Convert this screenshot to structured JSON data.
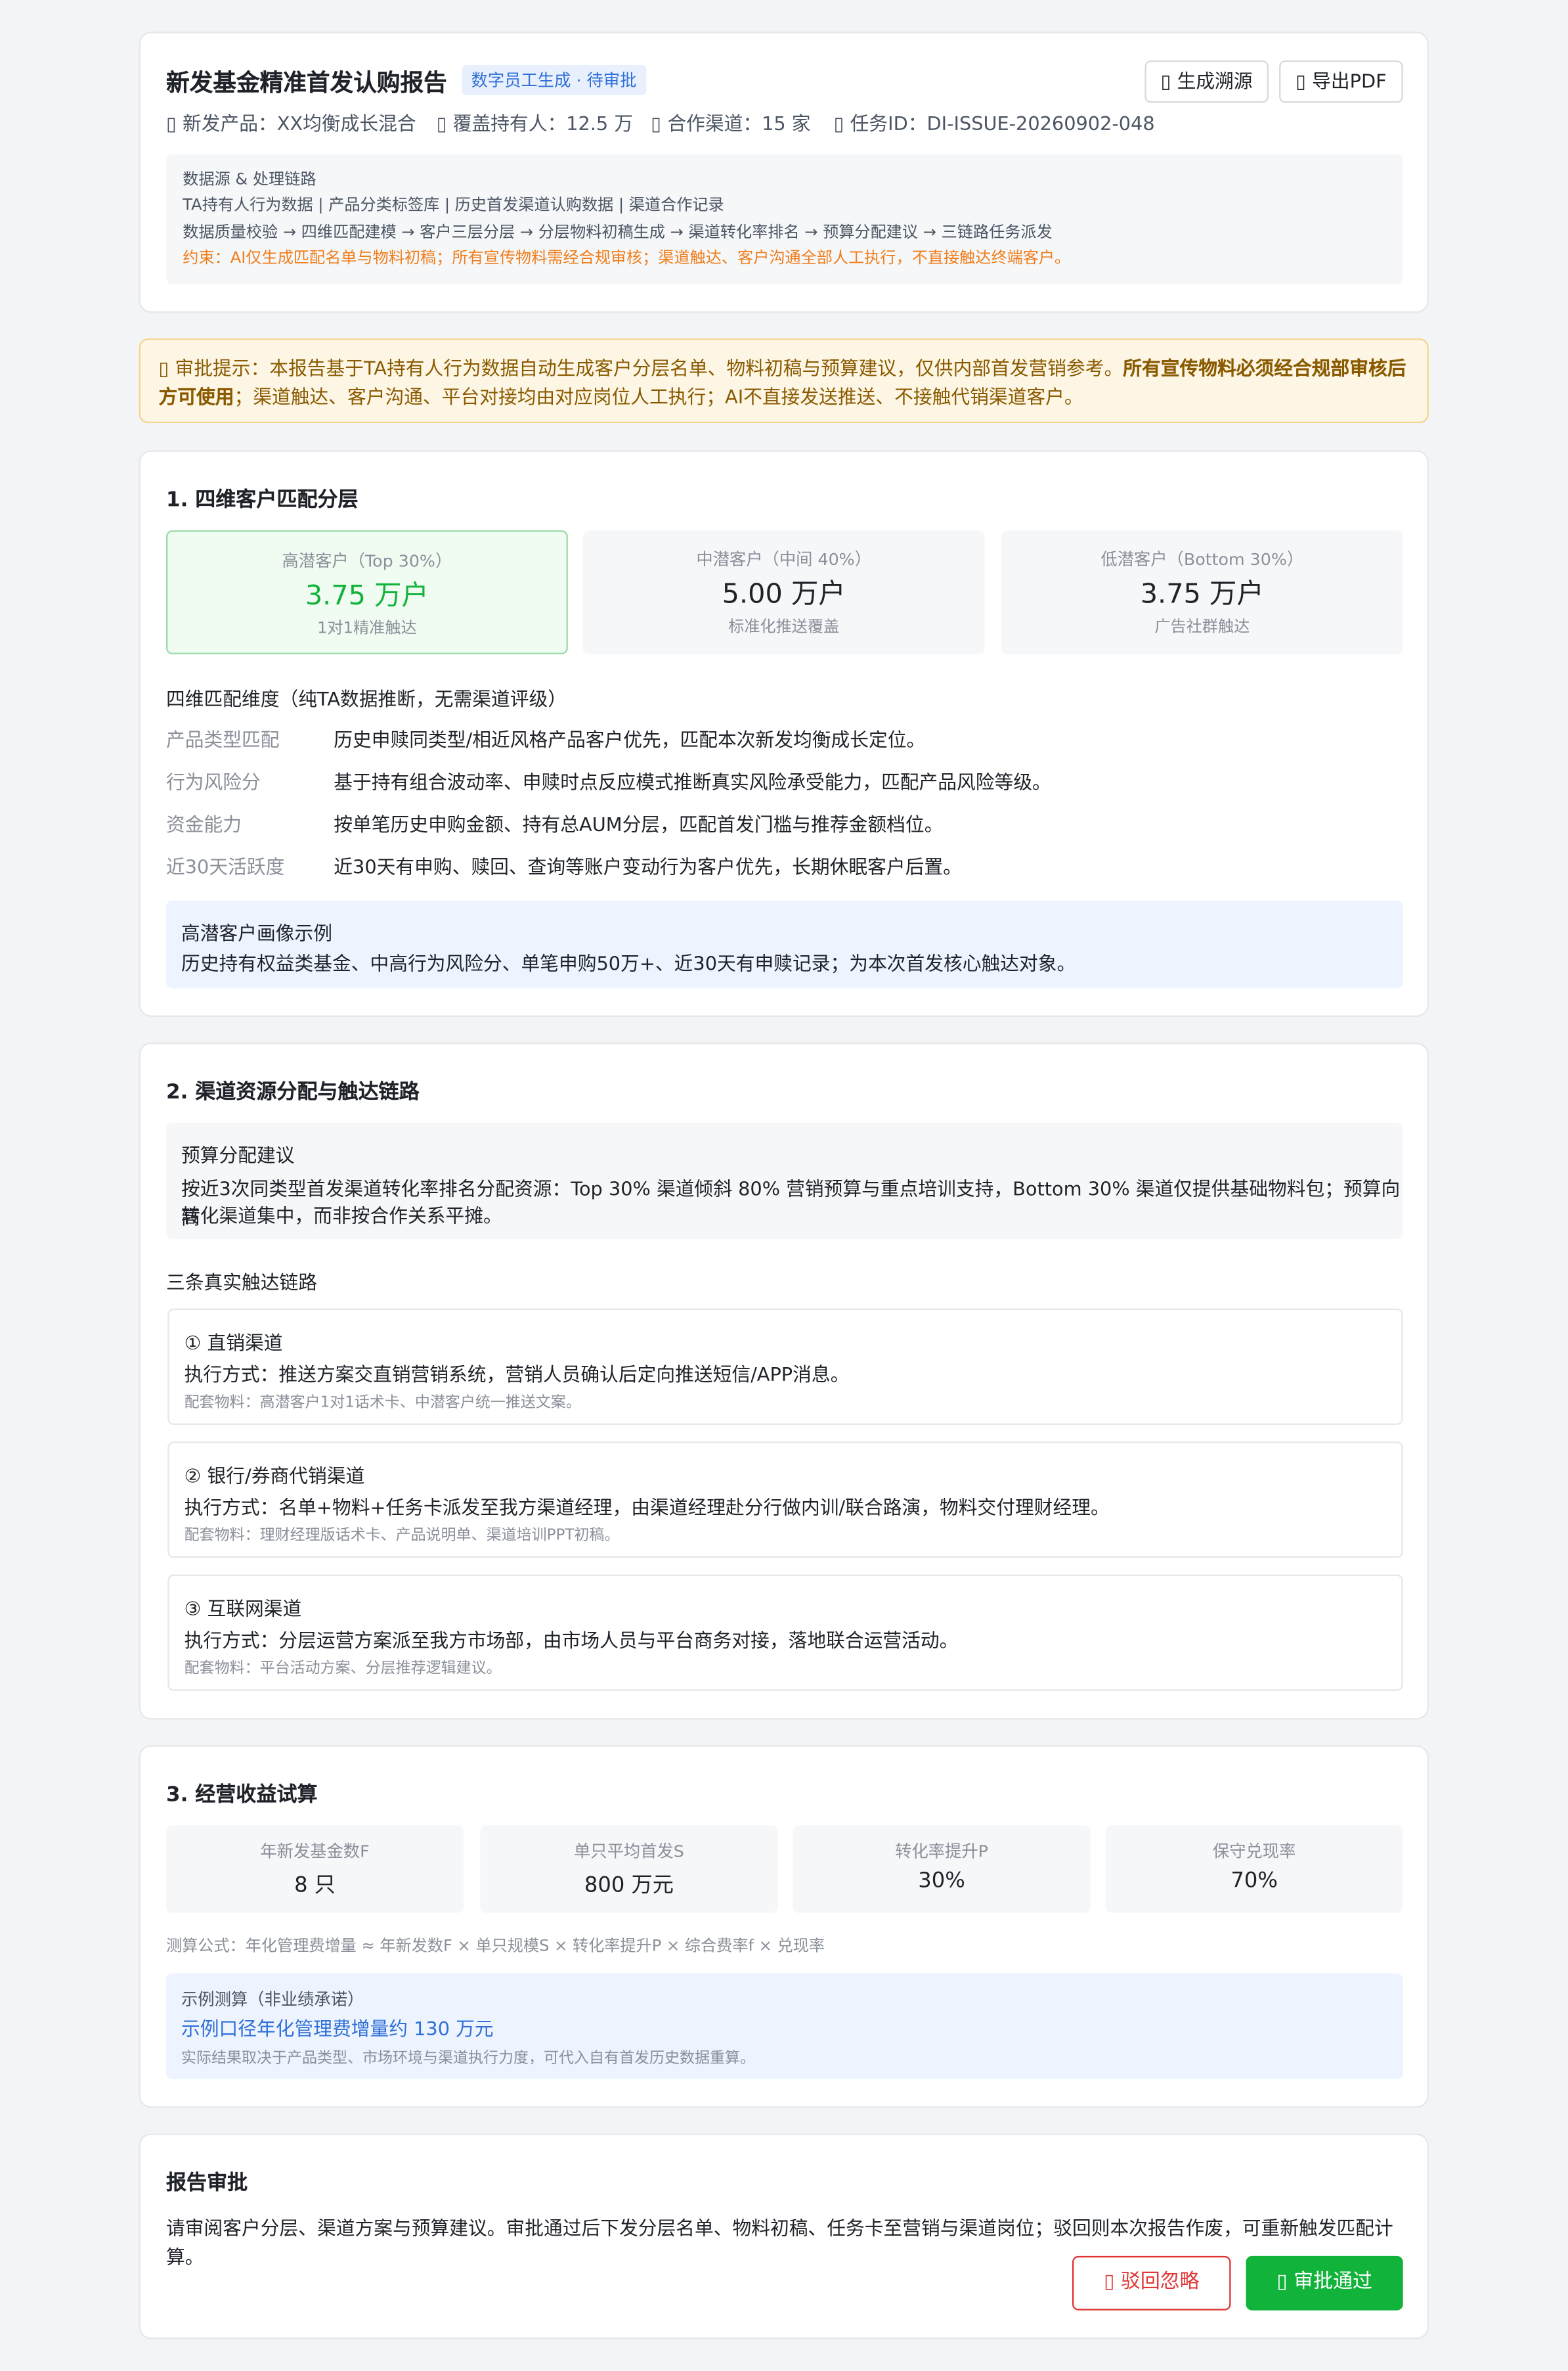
{
  "header": {
    "title": "新发基金精准首发认购报告",
    "tag": "数字员工生成 · 待审批",
    "btn_trace": "生成溯源",
    "btn_export": "导出PDF",
    "meta_product": "新发产品：XX均衡成长混合",
    "meta_holders": "覆盖持有人：12.5 万",
    "meta_channels": "合作渠道：15 家",
    "meta_task": "任务ID：DI-ISSUE-20260902-048",
    "source_title": "数据源 & 处理链路",
    "source_line1": "TA持有人行为数据 | 产品分类标签库 | 历史首发渠道认购数据 | 渠道合作记录",
    "source_line2": "数据质量校验 → 四维匹配建模 → 客户三层分层 → 分层物料初稿生成 → 渠道转化率排名 → 预算分配建议 → 三链路任务派发",
    "constraint": "约束：AI仅生成匹配名单与物料初稿；所有宣传物料需经合规审核；渠道触达、客户沟通全部人工执行，不直接触达终端客户。"
  },
  "notice": {
    "prefix": "审批提示：本报告基于TA持有人行为数据自动生成客户分层名单、物料初稿与预算建议，仅供内部首发营销参考。",
    "bold": "所有宣传物料必须经合规部审核后方可使用",
    "suffix": "；渠道触达、客户沟通、平台对接均由对应岗位人工执行；AI不直接发送推送、不接触代销渠道客户。"
  },
  "s1": {
    "title": "1. 四维客户匹配分层",
    "tiers": [
      {
        "label": "高潜客户（Top 30%）",
        "value": "3.75 万户",
        "sub": "1对1精准触达"
      },
      {
        "label": "中潜客户（中间 40%）",
        "value": "5.00 万户",
        "sub": "标准化推送覆盖"
      },
      {
        "label": "低潜客户（Bottom 30%）",
        "value": "3.75 万户",
        "sub": "广告社群触达"
      }
    ],
    "dims_title": "四维匹配维度（纯TA数据推断，无需渠道评级）",
    "dims": [
      {
        "label": "产品类型匹配",
        "text": "历史申赎同类型/相近风格产品客户优先，匹配本次新发均衡成长定位。"
      },
      {
        "label": "行为风险分",
        "text": "基于持有组合波动率、申赎时点反应模式推断真实风险承受能力，匹配产品风险等级。"
      },
      {
        "label": "资金能力",
        "text": "按单笔历史申购金额、持有总AUM分层，匹配首发门槛与推荐金额档位。"
      },
      {
        "label": "近30天活跃度",
        "text": "近30天有申购、赎回、查询等账户变动行为客户优先，长期休眠客户后置。"
      }
    ],
    "persona_title": "高潜客户画像示例",
    "persona_text": "历史持有权益类基金、中高行为风险分、单笔申购50万+、近30天有申赎记录；为本次首发核心触达对象。"
  },
  "s2": {
    "title": "2. 渠道资源分配与触达链路",
    "budget_title": "预算分配建议",
    "budget_line1": "按近3次同类型首发渠道转化率排名分配资源：Top 30% 渠道倾斜 80% 营销预算与重点培训支持，Bottom 30% 渠道仅提供基础物料包；预算向高",
    "budget_line2": "转化渠道集中，而非按合作关系平摊。",
    "chains_title": "三条真实触达链路",
    "chains": [
      {
        "name": "① 直销渠道",
        "exec": "执行方式：推送方案交直销营销系统，营销人员确认后定向推送短信/APP消息。",
        "material": "配套物料：高潜客户1对1话术卡、中潜客户统一推送文案。"
      },
      {
        "name": "② 银行/券商代销渠道",
        "exec": "执行方式：名单+物料+任务卡派发至我方渠道经理，由渠道经理赴分行做内训/联合路演，物料交付理财经理。",
        "material": "配套物料：理财经理版话术卡、产品说明单、渠道培训PPT初稿。"
      },
      {
        "name": "③ 互联网渠道",
        "exec": "执行方式：分层运营方案派至我方市场部，由市场人员与平台商务对接，落地联合运营活动。",
        "material": "配套物料：平台活动方案、分层推荐逻辑建议。"
      }
    ]
  },
  "s3": {
    "title": "3. 经营收益试算",
    "params": [
      {
        "label": "年新发基金数F",
        "value": "8 只"
      },
      {
        "label": "单只平均首发S",
        "value": "800 万元"
      },
      {
        "label": "转化率提升P",
        "value": "30%"
      },
      {
        "label": "保守兑现率",
        "value": "70%"
      }
    ],
    "formula": "测算公式：年化管理费增量 ≈ 年新发数F × 单只规模S × 转化率提升P × 综合费率f × 兑现率",
    "example_title": "示例测算（非业绩承诺）",
    "example_value": "示例口径年化管理费增量约 130 万元",
    "example_note": "实际结果取决于产品类型、市场环境与渠道执行力度，可代入自有首发历史数据重算。"
  },
  "approval": {
    "title": "报告审批",
    "text": "请审阅客户分层、渠道方案与预算建议。审批通过后下发分层名单、物料初稿、任务卡至营销与渠道岗位；驳回则本次报告作废，可重新触发匹配计算。",
    "reject": "驳回忽略",
    "approve": "审批通过"
  },
  "colors": {
    "accent_green": "#12b33b",
    "reject_red": "#e03636",
    "tag_blue": "#2f6fd6",
    "notice_bg": "#fdf6e4",
    "notice_text": "#8a5a00"
  },
  "icons": {
    "trace": "document-icon",
    "export": "download-icon",
    "meta": "info-icon",
    "notice": "warning-icon",
    "reject": "close-icon",
    "approve": "check-icon"
  }
}
